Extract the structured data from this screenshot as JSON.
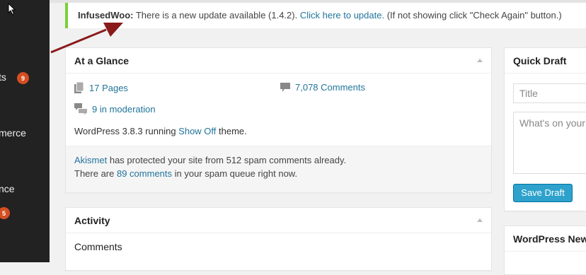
{
  "sidebar": {
    "items": [
      {
        "label": "ts",
        "badge": "9"
      },
      {
        "label": "merce"
      },
      {
        "label": "nce",
        "badge": "5"
      }
    ]
  },
  "notice": {
    "plugin": "InfusedWoo:",
    "message": " There is a new update available (1.4.2). ",
    "link": "Click here to update.",
    "tail": " (If not showing click \"Check Again\" button.)"
  },
  "glance": {
    "title": "At a Glance",
    "pages": "17 Pages",
    "comments": "7,078 Comments",
    "moderation": "9 in moderation",
    "wp_prefix": "WordPress 3.8.3 running ",
    "theme": "Show Off",
    "wp_suffix": " theme.",
    "akismet_link": "Akismet",
    "akismet_text": " has protected your site from 512 spam comments already.",
    "queue_prefix": "There are ",
    "queue_link": "89 comments",
    "queue_suffix": " in your spam queue right now."
  },
  "activity": {
    "title": "Activity",
    "comments_label": "Comments"
  },
  "quick_draft": {
    "title": "Quick Draft",
    "title_placeholder": "Title",
    "content_placeholder": "What's on your mind?",
    "save_label": "Save Draft"
  },
  "news": {
    "title": "WordPress News"
  },
  "colors": {
    "link": "#21759b",
    "sidebar": "#222222",
    "badge": "#d54e21",
    "notice_border": "#7ad03a",
    "primary_button": "#2ea2cc",
    "arrow": "#8b1a1a"
  }
}
